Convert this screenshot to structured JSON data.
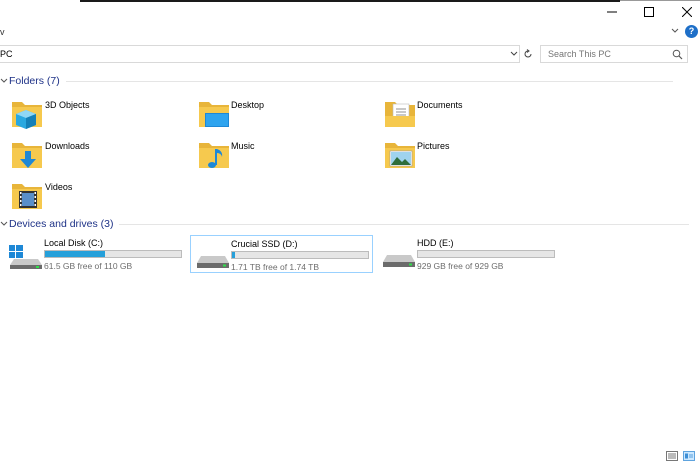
{
  "window": {
    "minimize_glyph": "—",
    "maximize_glyph": "☐",
    "close_glyph": "✕"
  },
  "ribbon": {
    "partial_label": "v",
    "help_label": "?"
  },
  "address": {
    "path_text": "PC"
  },
  "search": {
    "placeholder": "Search This PC"
  },
  "folders": {
    "header": "Folders (7)",
    "items": [
      {
        "label": "3D Objects",
        "icon": "3d-objects-folder-icon"
      },
      {
        "label": "Desktop",
        "icon": "desktop-folder-icon"
      },
      {
        "label": "Documents",
        "icon": "documents-folder-icon"
      },
      {
        "label": "Downloads",
        "icon": "downloads-folder-icon"
      },
      {
        "label": "Music",
        "icon": "music-folder-icon"
      },
      {
        "label": "Pictures",
        "icon": "pictures-folder-icon"
      },
      {
        "label": "Videos",
        "icon": "videos-folder-icon"
      }
    ]
  },
  "drives": {
    "header": "Devices and drives (3)",
    "items": [
      {
        "name": "Local Disk (C:)",
        "free_text": "61.5 GB free of 110 GB",
        "used_fraction": 0.44,
        "icon": "windows-drive-icon",
        "selected": false
      },
      {
        "name": "Crucial SSD  (D:)",
        "free_text": "1.71 TB free of 1.74 TB",
        "used_fraction": 0.02,
        "icon": "drive-icon",
        "selected": true
      },
      {
        "name": "HDD (E:)",
        "free_text": "929 GB free of 929 GB",
        "used_fraction": 0.0,
        "icon": "drive-icon",
        "selected": false
      }
    ]
  },
  "colors": {
    "accent": "#26a0da",
    "section_title": "#1e3287",
    "folder_yellow": "#f6c94e",
    "selection_border": "#99d1ff"
  }
}
